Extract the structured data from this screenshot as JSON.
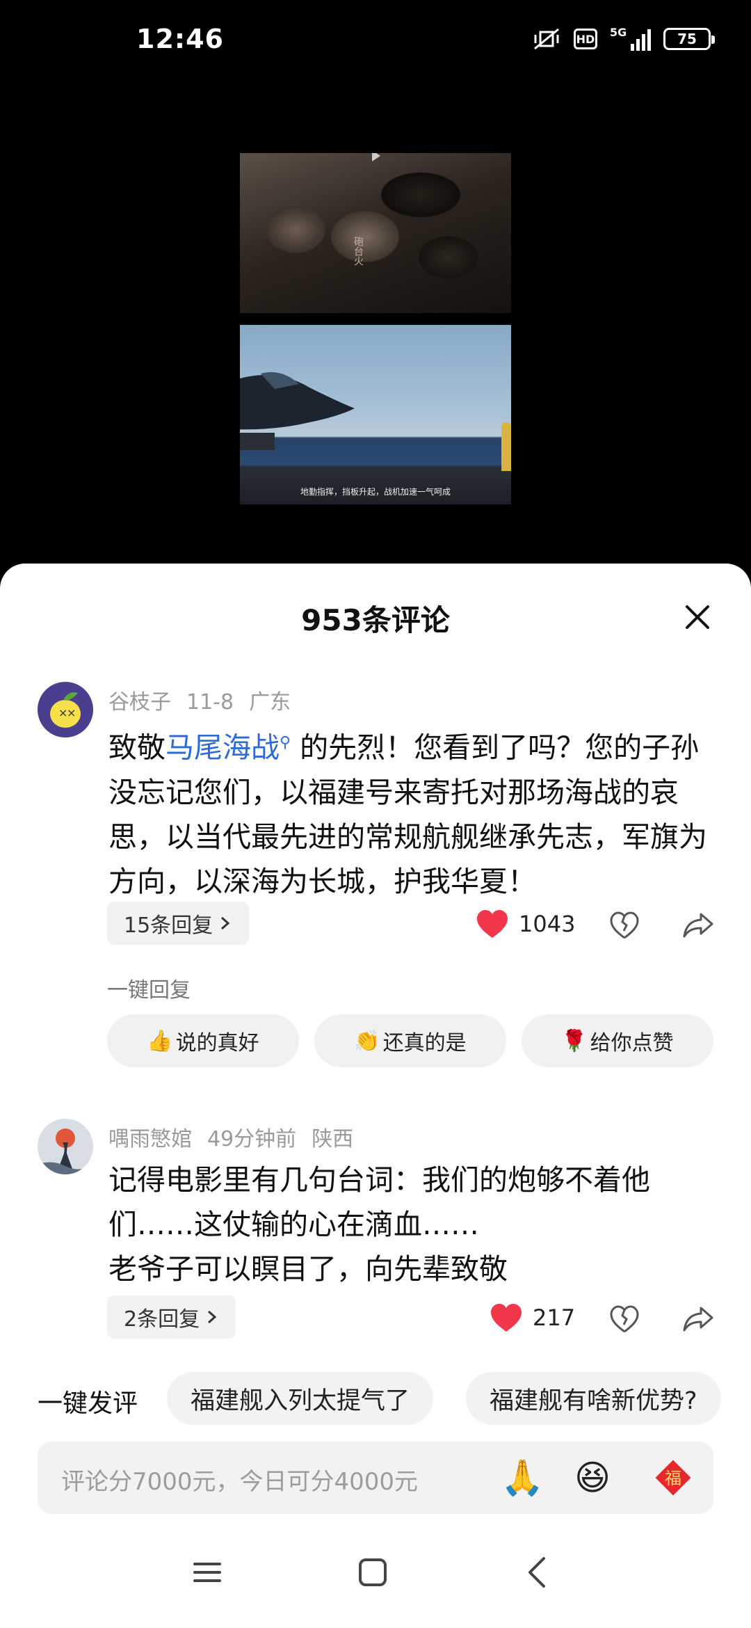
{
  "status_bar": {
    "time": "12:46",
    "network": "5G",
    "hd": "HD",
    "battery": "75"
  },
  "video": {
    "subtitle": "地勤指挥，挡板升起，战机加速一气呵成",
    "jar_label": "砲台火"
  },
  "comments_sheet": {
    "title": "953条评论",
    "comments": [
      {
        "user": "谷枝子",
        "date": "11-8",
        "location": "广东",
        "text_prefix": "致敬",
        "topic_link": "马尾海战",
        "text_suffix": " 的先烈！您看到了吗？您的子孙没忘记您们，以福建号来寄托对那场海战的哀思，以当代最先进的常规航舰继承先志，军旗为方向，以深海为长城，护我华夏！",
        "replies_label": "15条回复",
        "likes": "1043"
      },
      {
        "user": "喁雨慜婠",
        "date": "49分钟前",
        "location": "陕西",
        "text": "记得电影里有几句台词：我们的炮够不着他们……这仗输的心在滴血……\n老爷子可以瞑目了，向先辈致敬",
        "replies_label": "2条回复",
        "likes": "217"
      }
    ],
    "quick_reply": {
      "label": "一键回复",
      "options": [
        {
          "emoji": "👍",
          "text": "说的真好"
        },
        {
          "emoji": "👏",
          "text": "还真的是"
        },
        {
          "emoji": "🌹",
          "text": "给你点赞"
        }
      ]
    },
    "quick_post": {
      "label": "一键发评",
      "suggestions": [
        "福建舰入列太提气了",
        "福建舰有啥新优势?"
      ]
    },
    "input": {
      "placeholder": "评论分7000元，今日可分4000元",
      "emoji_1": "🙏",
      "emoji_2": "😆",
      "fu_char": "福"
    }
  },
  "colors": {
    "like_red": "#f2374b",
    "link_blue": "#2e6bd6",
    "fu_red": "#e8272c"
  },
  "nav_icons": [
    "menu-icon",
    "home-square-icon",
    "back-icon"
  ]
}
